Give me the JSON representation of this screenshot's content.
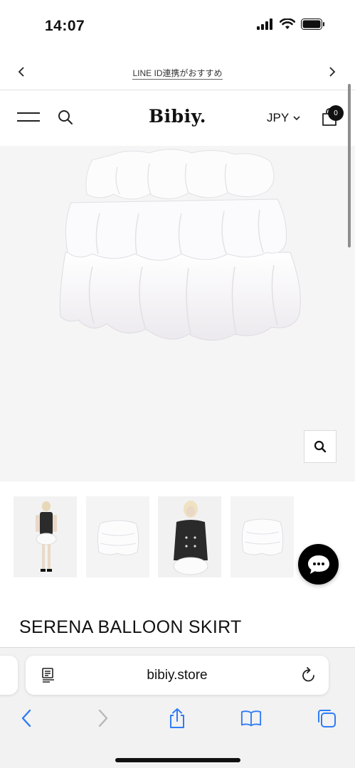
{
  "status_bar": {
    "time": "14:07",
    "icons": [
      "signal-icon",
      "wifi-icon",
      "battery-icon"
    ]
  },
  "promo_bar": {
    "text": "LINE ID連携がおすすめ",
    "prev_icon": "chevron-left-icon",
    "next_icon": "chevron-right-icon"
  },
  "header": {
    "logo": "Bibiy.",
    "currency": "JPY",
    "cart_count": "0",
    "menu_icon": "hamburger-icon",
    "search_icon": "search-icon",
    "cart_icon": "shopping-bag-icon"
  },
  "product": {
    "title": "SERENA BALLOON SKIRT",
    "main_image": "white-tiered-balloon-skirt",
    "thumbnails": [
      "model-front",
      "skirt-flat",
      "model-closeup",
      "skirt-flat-2"
    ]
  },
  "safari": {
    "url": "bibiy.store",
    "toolbar": [
      "back-icon",
      "forward-icon",
      "share-icon",
      "bookmarks-icon",
      "tabs-icon"
    ]
  },
  "colors": {
    "accent_blue": "#2f7cf6",
    "disabled_gray": "#b8b8b8",
    "hero_bg": "#f5f5f5"
  }
}
